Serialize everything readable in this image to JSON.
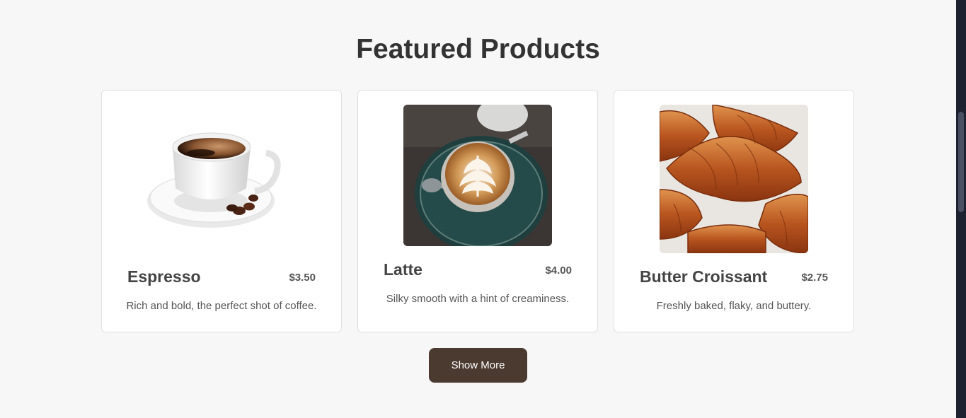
{
  "section": {
    "title": "Featured Products"
  },
  "products": [
    {
      "name": "Espresso",
      "price": "$3.50",
      "description": "Rich and bold, the perfect shot of coffee.",
      "image_icon": "espresso-cup-icon"
    },
    {
      "name": "Latte",
      "price": "$4.00",
      "description": "Silky smooth with a hint of creaminess.",
      "image_icon": "latte-art-icon"
    },
    {
      "name": "Butter Croissant",
      "price": "$2.75",
      "description": "Freshly baked, flaky, and buttery.",
      "image_icon": "croissant-icon"
    }
  ],
  "actions": {
    "show_more_label": "Show More"
  },
  "colors": {
    "button": "#4b3a30",
    "background": "#f7f7f7",
    "card": "#ffffff"
  }
}
